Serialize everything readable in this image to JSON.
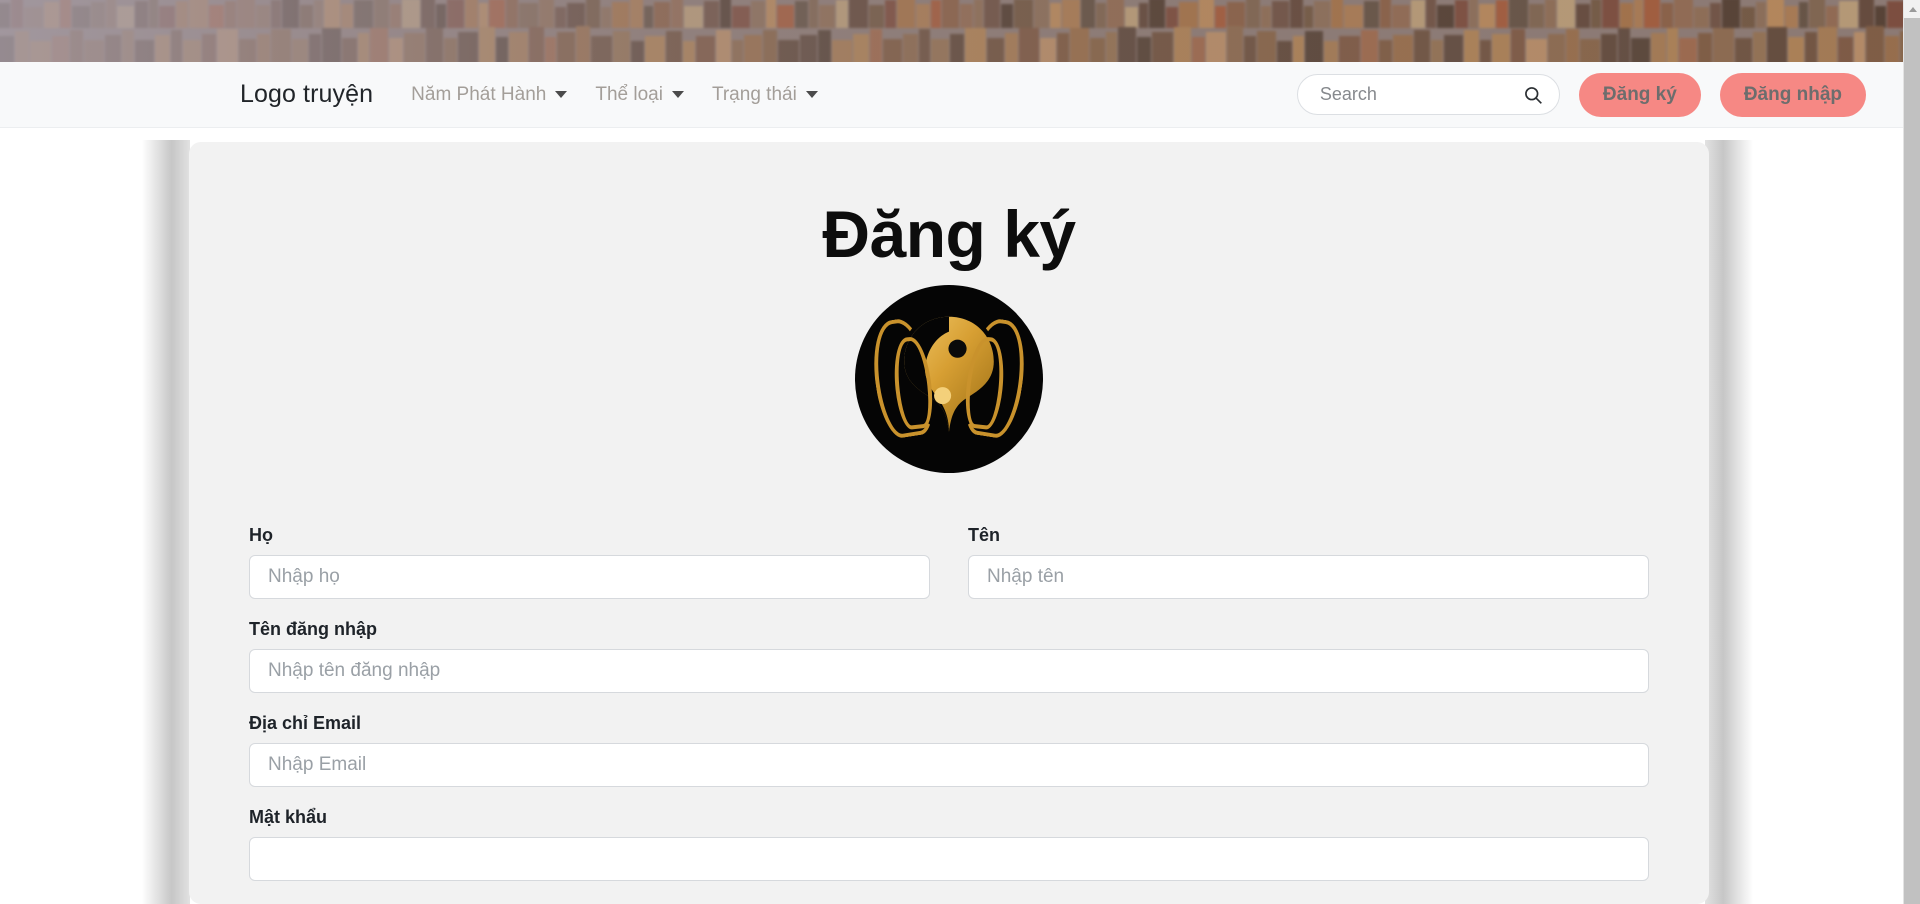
{
  "navbar": {
    "brand": "Logo truyện",
    "menu": [
      {
        "label": "Năm Phát Hành",
        "icon": "chevron-down-icon"
      },
      {
        "label": "Thể loại",
        "icon": "chevron-down-icon"
      },
      {
        "label": "Trạng thái",
        "icon": "chevron-down-icon"
      }
    ],
    "search": {
      "placeholder": "Search",
      "value": "",
      "icon": "search-icon"
    },
    "buttons": {
      "register": "Đăng ký",
      "login": "Đăng nhập"
    }
  },
  "card": {
    "title": "Đăng ký",
    "logo_alt": "yin-yang-hands-logo",
    "form": {
      "fields": [
        {
          "label": "Họ",
          "placeholder": "Nhập họ",
          "value": "",
          "name": "last-name"
        },
        {
          "label": "Tên",
          "placeholder": "Nhập tên",
          "value": "",
          "name": "first-name"
        },
        {
          "label": "Tên đăng nhập",
          "placeholder": "Nhập tên đăng nhập",
          "value": "",
          "name": "username"
        },
        {
          "label": "Địa chỉ Email",
          "placeholder": "Nhập Email",
          "value": "",
          "name": "email"
        },
        {
          "label": "Mật khẩu",
          "placeholder": "",
          "value": "",
          "name": "password"
        }
      ]
    }
  },
  "colors": {
    "accent": "#f68884",
    "card_bg": "#f2f2f2",
    "navbar_bg": "#f8f9fa",
    "logo_gold": "#c9922c",
    "text_dark": "#0d0d0d",
    "muted": "#a39e99"
  },
  "scrollbar": {
    "up_arrow_icon": "chevron-up-icon"
  }
}
